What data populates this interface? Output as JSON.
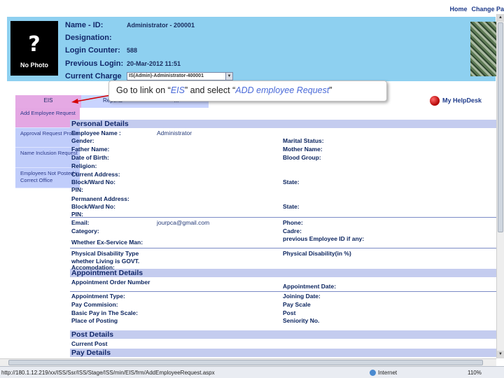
{
  "top_links": {
    "home": "Home",
    "change_password": "Change Pa"
  },
  "profile": {
    "photo_caption": "No Photo",
    "photo_glyph": "?",
    "name_label": "Name - ID:",
    "name_value": "Administrator - 200001",
    "designation_label": "Designation:",
    "designation_value": "",
    "login_counter_label": "Login Counter:",
    "login_counter_value": "588",
    "previous_login_label": "Previous Login:",
    "previous_login_value": "20-Mar-2012 11:51",
    "current_charge_label": "Current Charge",
    "current_charge_value": "IS(Admin)-Administrator-400001"
  },
  "menu": {
    "tabs": [
      "EIS",
      "Reports",
      "..."
    ],
    "submenu": [
      "Add Employee Request",
      "Approval Request Profile",
      "Name Inclusion Request",
      "Employees Not Posted in Correct Office"
    ]
  },
  "callout": {
    "prefix": "Go to link on “",
    "link1": "EIS",
    "middle": "” and select “",
    "link2": "ADD employee Request",
    "suffix": "”"
  },
  "helpdesk": {
    "label": "My HelpDesk",
    "icon": "red-ball-icon"
  },
  "sections": {
    "personal": "Personal Details",
    "appointment": "Appointment Details",
    "post": "Post Details",
    "pay": "Pay Details"
  },
  "personal_fields": {
    "employee_name": "Employee Name :",
    "employee_name_value": "Administrator",
    "gender": "Gender:",
    "father_name": "Father Name:",
    "dob": "Date of Birth:",
    "religion": "Religion:",
    "current_address": "Current Address:",
    "block_ward": "Block/Ward No:",
    "pin": "PIN:",
    "permanent_address": "Permanent Address:",
    "block_ward_2": "Block/Ward No:",
    "pin_2": "PIN:",
    "email": "Email:",
    "email_value": "jourpca@gmail.com",
    "category": "Category:",
    "ex_service": "Whether Ex-Service Man:",
    "physical_disability_type": "Physical Disability Type",
    "govt_accommodation": "whether Living is GOVT. Accomodation:",
    "marital_status": "Marital Status:",
    "mother_name": "Mother Name:",
    "blood_group": "Blood Group:",
    "state": "State:",
    "state_2": "State:",
    "phone": "Phone:",
    "cadre": "Cadre:",
    "previous_employee_id": "previous Employee ID if any:",
    "physical_disability_pct": "Physical Disability(in %)"
  },
  "appointment_fields": {
    "appointment_order_number": "Appointment Order Number",
    "appointment_type": "Appointment Type:",
    "pay_commission": "Pay Commision:",
    "basic_pay": "Basic Pay in The Scale:",
    "place_of_posting": "Place of Posting",
    "appointment_date": "Appointment Date:",
    "joining_date": "Joining Date:",
    "pay_scale": "Pay Scale",
    "post": "Post",
    "seniority_no": "Seniority No."
  },
  "post_fields": {
    "current_post": "Current Post"
  },
  "statusbar": {
    "url": "http://180.1.12.219/xx/ISS/Ssr/ISS/Stage/ISS/min/EIS/frm/AddEmployeeRequest.aspx",
    "zone": "Internet",
    "zoom": "110%"
  },
  "colors": {
    "header_bg": "#8ed0f0",
    "menu_bg": "#c9d4ff",
    "menu_active": "#e5a9e4",
    "section_bar": "#c4ccef",
    "arrow": "#d40000"
  }
}
